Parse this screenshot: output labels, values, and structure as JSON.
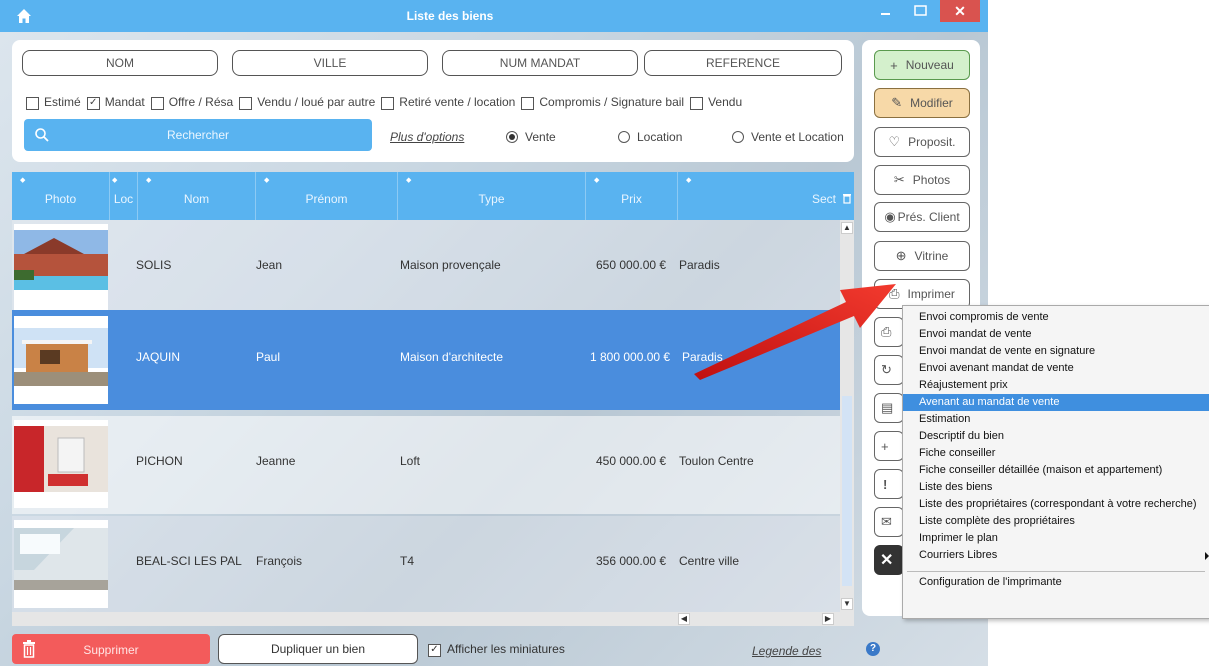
{
  "window": {
    "title": "Liste des biens",
    "minimize_glyph": "–",
    "maximize_glyph": "□",
    "close_glyph": "✕"
  },
  "search": {
    "fields": [
      "NOM",
      "VILLE",
      "NUM MANDAT",
      "REFERENCE"
    ],
    "checkboxes": [
      {
        "label": "Estimé",
        "checked": false
      },
      {
        "label": "Mandat",
        "checked": true
      },
      {
        "label": "Offre / Résa",
        "checked": false
      },
      {
        "label": "Vendu / loué par autre",
        "checked": false
      },
      {
        "label": "Retiré vente / location",
        "checked": false
      },
      {
        "label": "Compromis / Signature bail",
        "checked": false
      },
      {
        "label": "Vendu",
        "checked": false
      }
    ],
    "search_button": "Rechercher",
    "more_options": "Plus d'options",
    "radios": [
      {
        "label": "Vente",
        "selected": true
      },
      {
        "label": "Location",
        "selected": false
      },
      {
        "label": "Vente et Location",
        "selected": false
      }
    ]
  },
  "table": {
    "columns": [
      "Photo",
      "Loc",
      "Nom",
      "Prénom",
      "Type",
      "Prix",
      "Sect"
    ],
    "rows": [
      {
        "nom": "SOLIS",
        "prenom": "Jean",
        "type": "Maison provençale",
        "prix": "650 000.00 €",
        "secteur": "Paradis"
      },
      {
        "nom": "JAQUIN",
        "prenom": "Paul",
        "type": "Maison d'architecte",
        "prix": "1 800 000.00 €",
        "secteur": "Paradis"
      },
      {
        "nom": "PICHON",
        "prenom": "Jeanne",
        "type": "Loft",
        "prix": "450 000.00 €",
        "secteur": "Toulon Centre"
      },
      {
        "nom": "BEAL-SCI LES PAL",
        "prenom": "François",
        "type": "T4",
        "prix": "356 000.00 €",
        "secteur": "Centre ville"
      }
    ],
    "selected_row": 2
  },
  "sidebar": {
    "buttons": [
      {
        "label": "Nouveau",
        "icon": "plus-icon"
      },
      {
        "label": "Modifier",
        "icon": "pencil-icon"
      },
      {
        "label": "Proposit.",
        "icon": "lightbulb-icon"
      },
      {
        "label": "Photos",
        "icon": "tools-icon"
      },
      {
        "label": "Prés. Client",
        "icon": "eye-icon"
      },
      {
        "label": "Vitrine",
        "icon": "target-icon"
      },
      {
        "label": "Imprimer",
        "icon": "printer-icon"
      }
    ],
    "partial_icons": [
      "printer-icon",
      "refresh-icon",
      "document-icon",
      "plus-icon",
      "exclamation-icon",
      "mail-icon",
      "close-icon"
    ]
  },
  "print_menu": {
    "items": [
      "Envoi compromis de vente",
      "Envoi mandat de vente",
      "Envoi mandat de vente en signature",
      "Envoi avenant mandat de vente",
      "Réajustement prix",
      "Avenant au mandat de vente",
      "Estimation",
      "Descriptif du bien",
      "Fiche conseiller",
      "Fiche conseiller détaillée (maison et appartement)",
      "Liste des biens",
      "Liste des propriétaires (correspondant à votre recherche)",
      "Liste complète des propriétaires",
      "Imprimer le plan",
      "Courriers Libres"
    ],
    "highlighted_index": 5,
    "config_item": "Configuration de l'imprimante"
  },
  "bottom": {
    "delete_button": "Supprimer",
    "duplicate_button": "Dupliquer un bien",
    "show_thumbnails": "Afficher les miniatures",
    "show_thumbnails_checked": true,
    "legend_link": "Legende des"
  },
  "colors": {
    "title_blue": "#59b3f0",
    "selected_row": "#4a8ddd",
    "delete_red": "#f35b5b",
    "annotation_arrow": "#e8201e"
  }
}
